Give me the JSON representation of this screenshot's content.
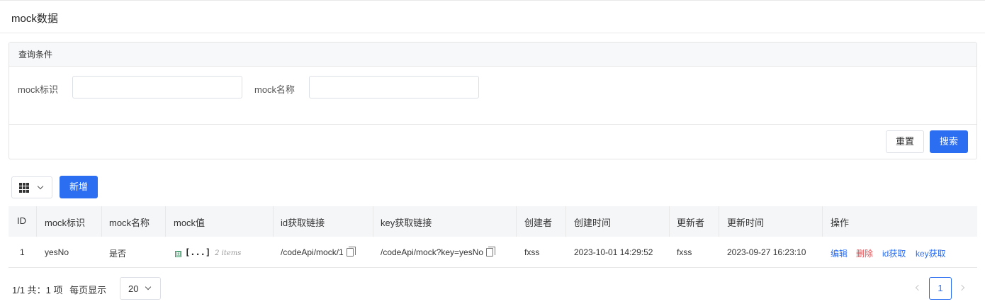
{
  "header": {
    "title": "mock数据"
  },
  "query": {
    "panel_title": "查询条件",
    "fields": [
      {
        "label": "mock标识",
        "value": "",
        "placeholder": ""
      },
      {
        "label": "mock名称",
        "value": "",
        "placeholder": ""
      }
    ],
    "reset_label": "重置",
    "search_label": "搜索"
  },
  "toolbar": {
    "add_label": "新增"
  },
  "table": {
    "columns": [
      "ID",
      "mock标识",
      "mock名称",
      "mock值",
      "id获取链接",
      "key获取链接",
      "创建者",
      "创建时间",
      "更新者",
      "更新时间",
      "操作"
    ],
    "rows": [
      {
        "id": "1",
        "mock_key": "yesNo",
        "mock_name": "是否",
        "mock_value": {
          "expand": "⊞",
          "brackets": "[...]",
          "items": "2 items"
        },
        "id_link": "/codeApi/mock/1",
        "key_link": "/codeApi/mock?key=yesNo",
        "creator": "fxss",
        "created_at": "2023-10-01 14:29:52",
        "updater": "fxss",
        "updated_at": "2023-09-27 16:23:10",
        "actions": {
          "edit": "编辑",
          "delete": "删除",
          "get_by_id": "id获取",
          "get_by_key": "key获取"
        }
      }
    ]
  },
  "pagination": {
    "summary": "1/1 共：1 项",
    "page_size_label": "每页显示",
    "page_size": "20",
    "current_page": "1"
  },
  "colors": {
    "primary": "#2c6ef2",
    "danger": "#e5484d",
    "header_bg": "#f5f6f8"
  }
}
